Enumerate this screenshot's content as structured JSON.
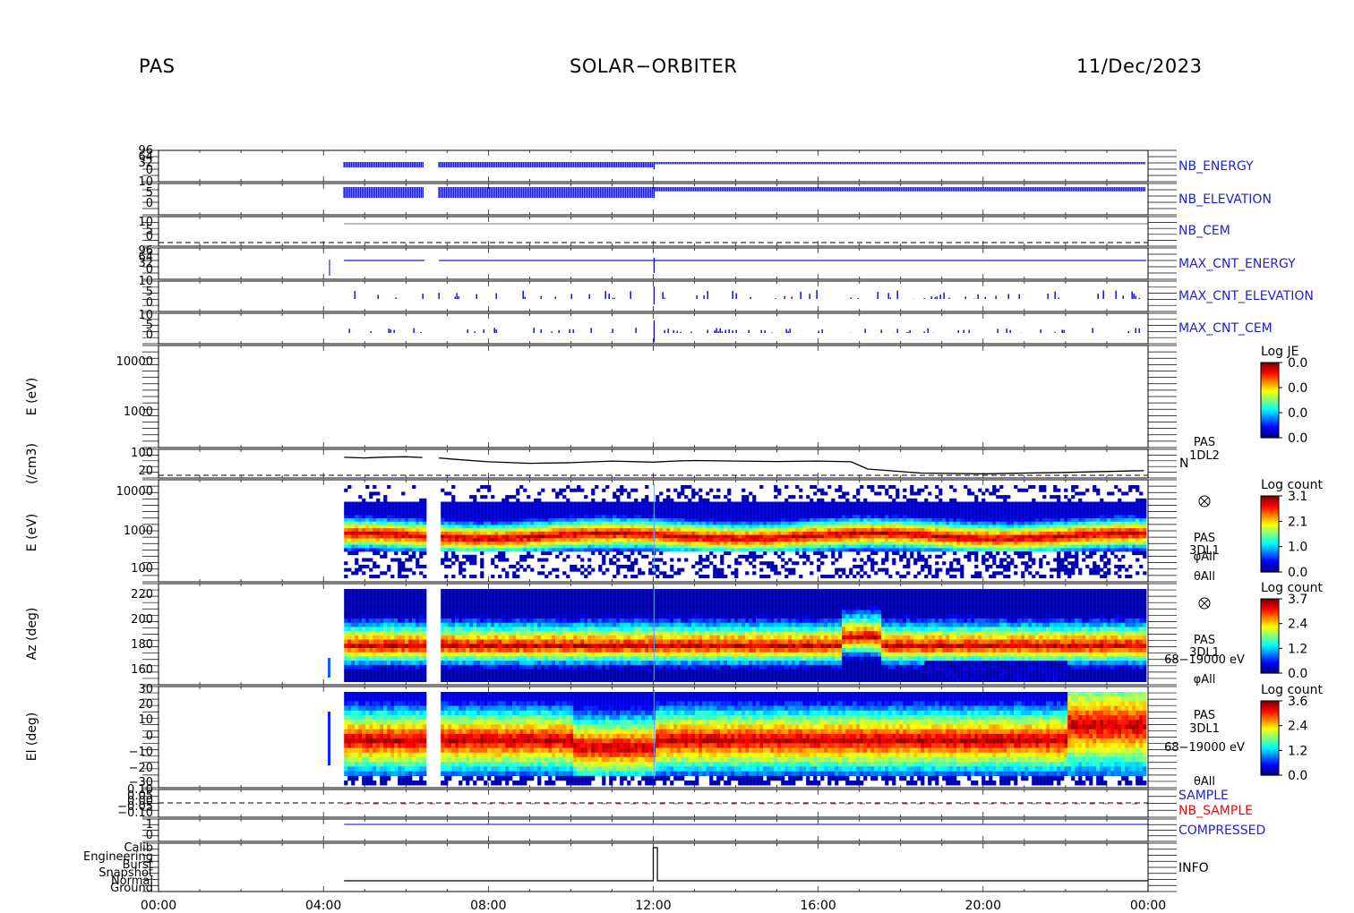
{
  "header": {
    "instrument": "PAS",
    "mission": "SOLAR−ORBITER",
    "date": "11/Dec/2023"
  },
  "colors": {
    "blue_label": "#2222cc",
    "red_label": "#dd1111",
    "trace_blue": "#0000cc",
    "trace_black": "#000000"
  },
  "chart_data": {
    "type": "line",
    "x_axis": {
      "tick_labels": [
        "00:00",
        "04:00",
        "08:00",
        "12:00",
        "16:00",
        "20:00",
        "00:00"
      ],
      "range_hours": [
        0,
        24
      ]
    },
    "data_gaps_hours": [
      [
        6.45,
        6.8
      ]
    ],
    "data_start_hour": 4.5,
    "panels": [
      {
        "id": "nb_energy",
        "label": "NB_ENERGY",
        "label_color": "blue",
        "tick_labels": [
          "96",
          "64",
          "32",
          "0"
        ],
        "description": "high-frequency blue energy stepping pattern",
        "event_hour": 12.05
      },
      {
        "id": "nb_elevation",
        "label": "NB_ELEVATION",
        "label_color": "blue",
        "tick_labels": [
          "10",
          "5",
          "0"
        ]
      },
      {
        "id": "nb_cem",
        "label": "NB_CEM",
        "label_color": "blue",
        "tick_labels": [
          "10",
          "5",
          "0"
        ]
      },
      {
        "id": "max_cnt_energy",
        "label": "MAX_CNT_ENERGY",
        "label_color": "blue",
        "tick_labels": [
          "96",
          "64",
          "32",
          "0"
        ]
      },
      {
        "id": "max_cnt_elevation",
        "label": "MAX_CNT_ELEVATION",
        "label_color": "blue",
        "tick_labels": [
          "10",
          "5",
          "0"
        ]
      },
      {
        "id": "max_cnt_cem",
        "label": "MAX_CNT_CEM",
        "label_color": "blue",
        "tick_labels": [
          "10",
          "5",
          "0"
        ]
      },
      {
        "id": "je_spectrogram",
        "ylabel": "E (eV)",
        "scale": "log",
        "tick_labels": [
          "10000",
          "1000"
        ],
        "colorbar": {
          "title": "Log JE",
          "ticks": [
            "0.0",
            "0.0",
            "0.0",
            "0.0"
          ]
        },
        "empty": true
      },
      {
        "id": "density",
        "ylabel": "(/cm3)",
        "right_label": "N",
        "side_text": [
          "PAS",
          "1DL2"
        ],
        "tick_labels": [
          "100",
          "20"
        ],
        "x": [
          4.5,
          5.0,
          5.5,
          6.0,
          6.4,
          6.8,
          7.2,
          8.0,
          9.0,
          10.0,
          11.0,
          12.0,
          12.5,
          13.0,
          14.0,
          15.0,
          16.0,
          16.8,
          17.2,
          18.5,
          20.0,
          22.0,
          23.9
        ],
        "values": [
          65,
          62,
          66,
          68,
          64,
          62,
          55,
          45,
          40,
          42,
          48,
          44,
          48,
          50,
          48,
          46,
          48,
          45,
          25,
          18,
          17,
          19,
          22
        ]
      },
      {
        "id": "energy_spectrogram",
        "ylabel": "E (eV)",
        "scale": "log",
        "tick_labels": [
          "10000",
          "1000",
          "100"
        ],
        "side_text": [
          "PAS",
          "3DL1",
          "φAll",
          "θAll"
        ],
        "colorbar": {
          "title": "Log count",
          "ticks": [
            "3.1",
            "2.1",
            "1.0",
            "0.0"
          ]
        },
        "peak_energy_ev": 600
      },
      {
        "id": "azimuth_spectrogram",
        "ylabel": "Az (deg)",
        "tick_labels": [
          "220",
          "200",
          "180",
          "160"
        ],
        "side_text": [
          "PAS",
          "3DL1",
          "68−19000 eV",
          "φAll"
        ],
        "colorbar": {
          "title": "Log count",
          "ticks": [
            "3.7",
            "2.4",
            "1.2",
            "0.0"
          ]
        },
        "peak_azimuth_deg": 180
      },
      {
        "id": "elevation_spectrogram",
        "ylabel": "El (deg)",
        "tick_labels": [
          "30",
          "20",
          "10",
          "0",
          "−10",
          "−20",
          "−30"
        ],
        "side_text": [
          "PAS",
          "3DL1",
          "68−19000 eV",
          "θAll"
        ],
        "colorbar": {
          "title": "Log count",
          "ticks": [
            "3.6",
            "2.4",
            "1.2",
            "0.0"
          ]
        },
        "peak_elevation_deg": 0
      },
      {
        "id": "sample",
        "labels": [
          "SAMPLE",
          "NB_SAMPLE"
        ],
        "label_colors": [
          "blue",
          "red"
        ],
        "tick_labels": [
          "0.10",
          "0.05",
          "0.00",
          "−0.05",
          "−0.10"
        ],
        "value": 0.0
      },
      {
        "id": "compressed",
        "label": "COMPRESSED",
        "label_color": "blue",
        "tick_labels": [
          "1",
          "0"
        ],
        "value": 1
      },
      {
        "id": "info",
        "label": "INFO",
        "tick_labels": [
          "Calib",
          "Engineering",
          "Burst",
          "Snapshot",
          "Normal",
          "Ground"
        ],
        "steps": [
          {
            "from": 4.5,
            "to": 12.0,
            "state": "Normal"
          },
          {
            "from": 12.0,
            "to": 12.1,
            "state": "Calib"
          },
          {
            "from": 12.1,
            "to": 24.0,
            "state": "Normal"
          }
        ]
      }
    ]
  }
}
